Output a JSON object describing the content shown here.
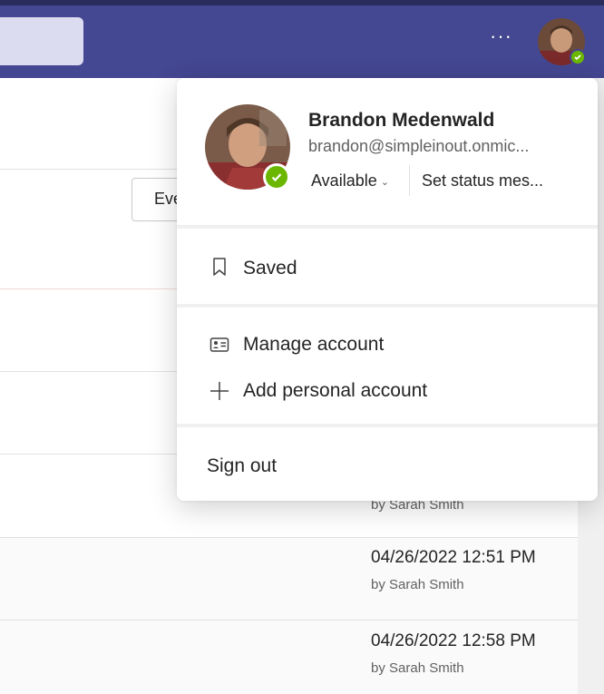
{
  "header": {
    "more_label": "···"
  },
  "background": {
    "filter_button_label": "Eve",
    "rows": [
      {
        "date": "",
        "by": "by Sarah Smith"
      },
      {
        "date": "04/26/2022 12:51 PM",
        "by": "by Sarah Smith"
      },
      {
        "date": "04/26/2022 12:58 PM",
        "by": "by Sarah Smith"
      }
    ]
  },
  "profile_menu": {
    "name": "Brandon Medenwald",
    "email": "brandon@simpleinout.onmic...",
    "status": "Available",
    "status_chevron": "⌄",
    "set_status": "Set status mes...",
    "saved": "Saved",
    "manage_account": "Manage account",
    "add_personal_account": "Add personal account",
    "sign_out": "Sign out"
  },
  "colors": {
    "accent": "#444791",
    "presence_available": "#6bb700"
  }
}
